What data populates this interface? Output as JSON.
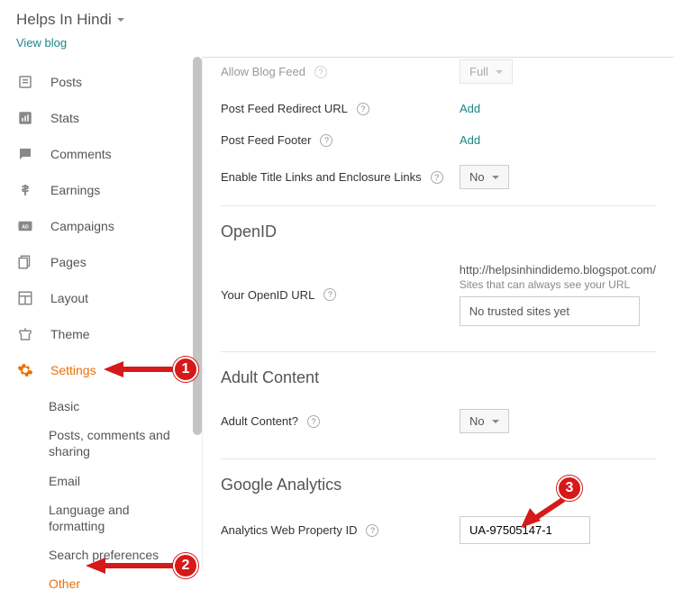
{
  "header": {
    "blogTitle": "Helps In Hindi",
    "viewBlog": "View blog"
  },
  "sidebar": {
    "items": [
      {
        "label": "Posts"
      },
      {
        "label": "Stats"
      },
      {
        "label": "Comments"
      },
      {
        "label": "Earnings"
      },
      {
        "label": "Campaigns"
      },
      {
        "label": "Pages"
      },
      {
        "label": "Layout"
      },
      {
        "label": "Theme"
      },
      {
        "label": "Settings"
      }
    ],
    "subItems": [
      {
        "label": "Basic"
      },
      {
        "label": "Posts, comments and sharing"
      },
      {
        "label": "Email"
      },
      {
        "label": "Language and formatting"
      },
      {
        "label": "Search preferences"
      },
      {
        "label": "Other"
      }
    ]
  },
  "content": {
    "allowBlogFeed": {
      "label": "Allow Blog Feed",
      "value": "Full"
    },
    "postFeedRedirect": {
      "label": "Post Feed Redirect URL",
      "action": "Add"
    },
    "postFeedFooter": {
      "label": "Post Feed Footer",
      "action": "Add"
    },
    "enableTitleLinks": {
      "label": "Enable Title Links and Enclosure Links",
      "value": "No"
    },
    "openid": {
      "title": "OpenID",
      "urlLabel": "Your OpenID URL",
      "url": "http://helpsinhindidemo.blogspot.com/",
      "note": "Sites that can always see your URL",
      "trusted": "No trusted sites yet"
    },
    "adult": {
      "title": "Adult Content",
      "label": "Adult Content?",
      "value": "No"
    },
    "analytics": {
      "title": "Google Analytics",
      "label": "Analytics Web Property ID",
      "value": "UA-97505147-1"
    }
  },
  "annotations": {
    "n1": "1",
    "n2": "2",
    "n3": "3"
  }
}
